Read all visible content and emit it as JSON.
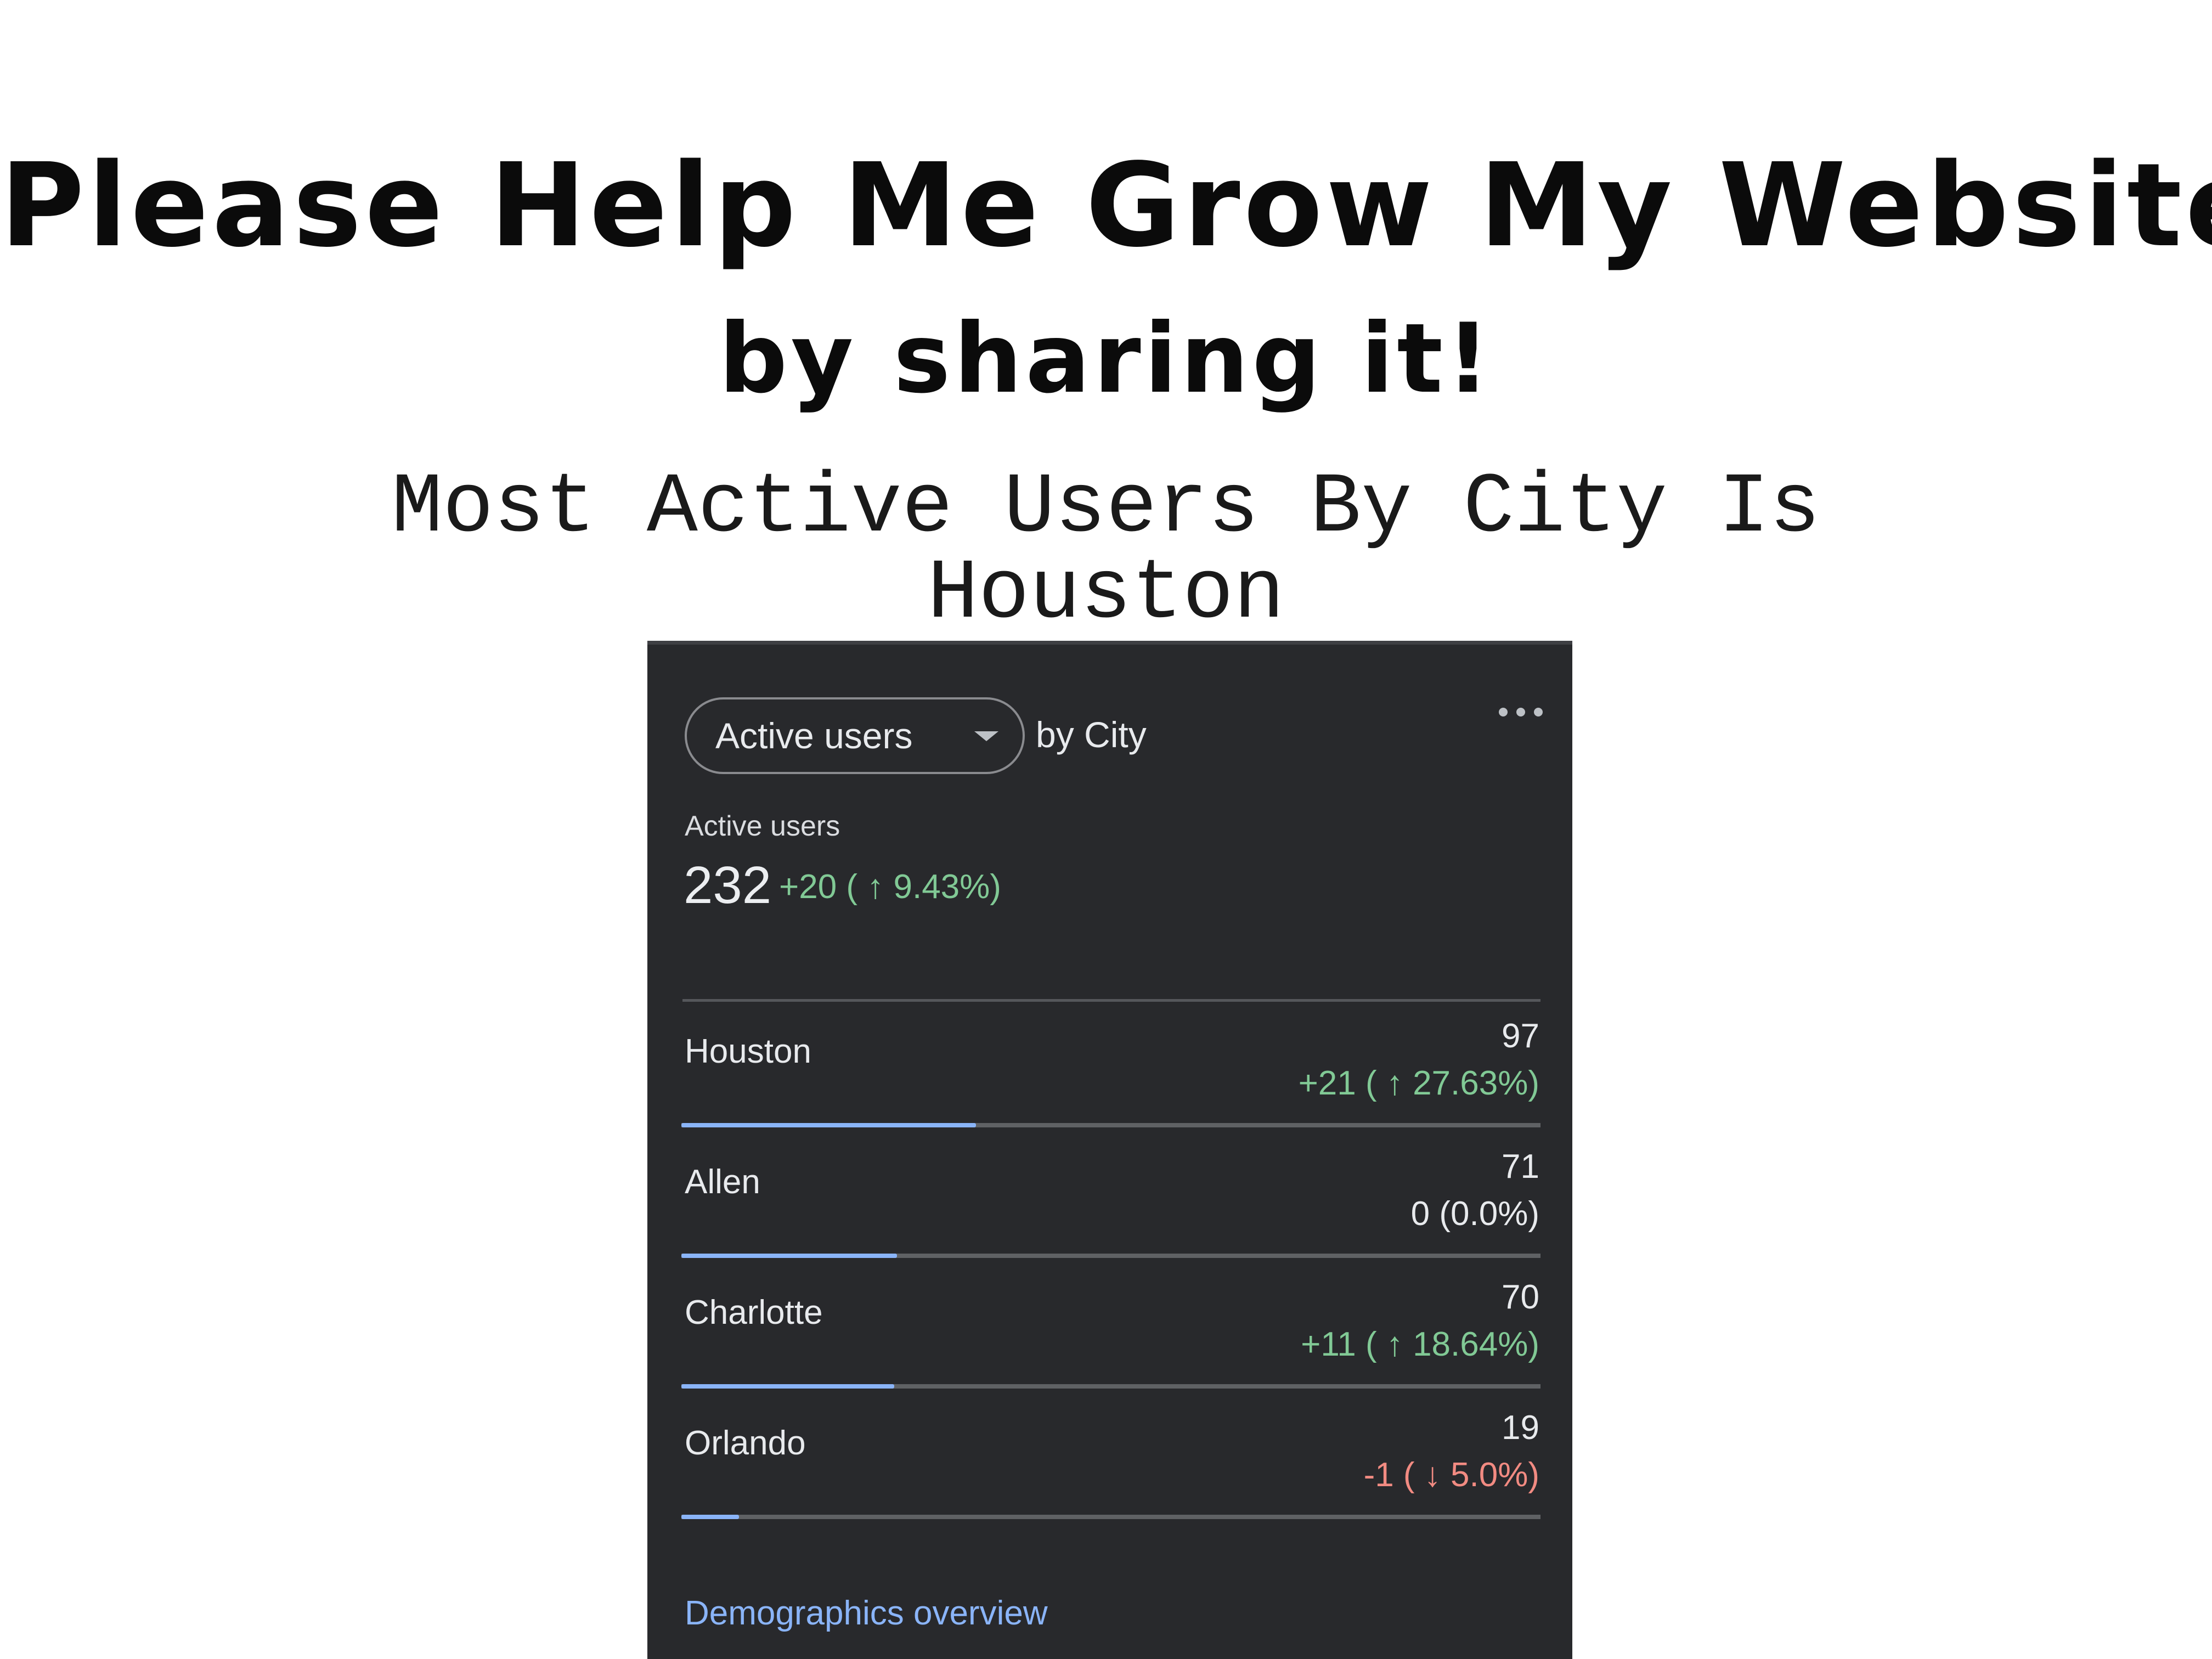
{
  "headline": {
    "line1": "Please Help Me Grow My Website",
    "line2": "by sharing it!"
  },
  "subheadline": {
    "line1": "Most Active Users By City Is",
    "line2": "Houston"
  },
  "card": {
    "metric_selector_label": "Active users",
    "dimension_label": "by City",
    "more_icon": "more-horizontal-icon",
    "dropdown_icon": "caret-down-icon",
    "summary": {
      "label": "Active users",
      "value": "232",
      "change": "+20 ( ↑ 9.43%)",
      "change_color": "#81c995"
    },
    "rows": [
      {
        "city": "Houston",
        "value": "97",
        "change": "+21 ( ↑ 27.63%)",
        "trend": "up",
        "share": 1.0
      },
      {
        "city": "Allen",
        "value": "71",
        "change": "0 (0.0%)",
        "trend": "flat",
        "share": 0.732
      },
      {
        "city": "Charlotte",
        "value": "70",
        "change": "+11 ( ↑ 18.64%)",
        "trend": "up",
        "share": 0.722
      },
      {
        "city": "Orlando",
        "value": "19",
        "change": "-1 ( ↓ 5.0%)",
        "trend": "down",
        "share": 0.196
      }
    ],
    "trend_colors": {
      "up": "#81c995",
      "flat": "#e8eaed",
      "down": "#f28b82"
    },
    "bar_color": "#8ab4f8",
    "footer_link": "Demographics overview"
  }
}
